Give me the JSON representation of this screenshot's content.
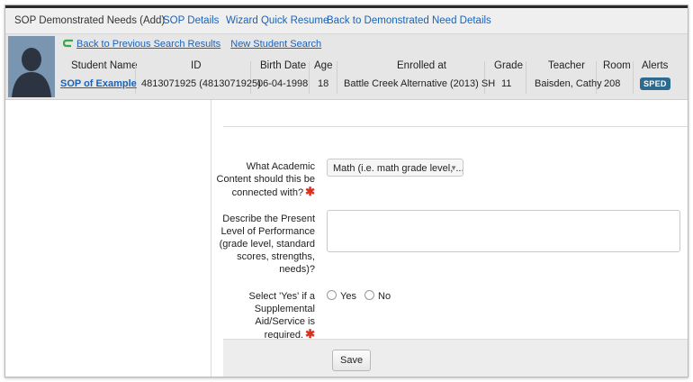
{
  "tabs": {
    "title": "SOP Demonstrated Needs (Add)",
    "sop_details": "SOP Details",
    "wizard_resume": "Wizard Quick Resume",
    "back_demonstrated": "Back to Demonstrated Need Details"
  },
  "nav": {
    "back_search": "Back to Previous Search Results",
    "new_search": "New Student Search"
  },
  "student": {
    "headers": {
      "name": "Student Name",
      "id": "ID",
      "birth_date": "Birth Date",
      "age": "Age",
      "enrolled": "Enrolled at",
      "grade": "Grade",
      "teacher": "Teacher",
      "room": "Room",
      "alerts": "Alerts"
    },
    "name": "SOP of Example",
    "id": "4813071925 (4813071925)",
    "birth_date": "06-04-1998",
    "age": "18",
    "enrolled": "Battle Creek Alternative (2013) SH",
    "grade": "11",
    "teacher": "Baisden, Cathy",
    "room": "208",
    "alert_badge": "SPED"
  },
  "form": {
    "academic_label": "What Academic Content should this be connected with?",
    "academic_value": "Math (i.e. math grade level, ...",
    "present_level_label": "Describe the Present Level of Performance (grade level, standard scores, strengths, needs)?",
    "present_level_value": "",
    "supplemental_label": "Select 'Yes' if a Supplemental Aid/Service is required.",
    "yes_label": "Yes",
    "no_label": "No",
    "required_mark": "✱",
    "save_label": "Save"
  },
  "colors": {
    "link": "#1a63b8",
    "required": "#d9301f",
    "badge": "#2d6a8f"
  }
}
